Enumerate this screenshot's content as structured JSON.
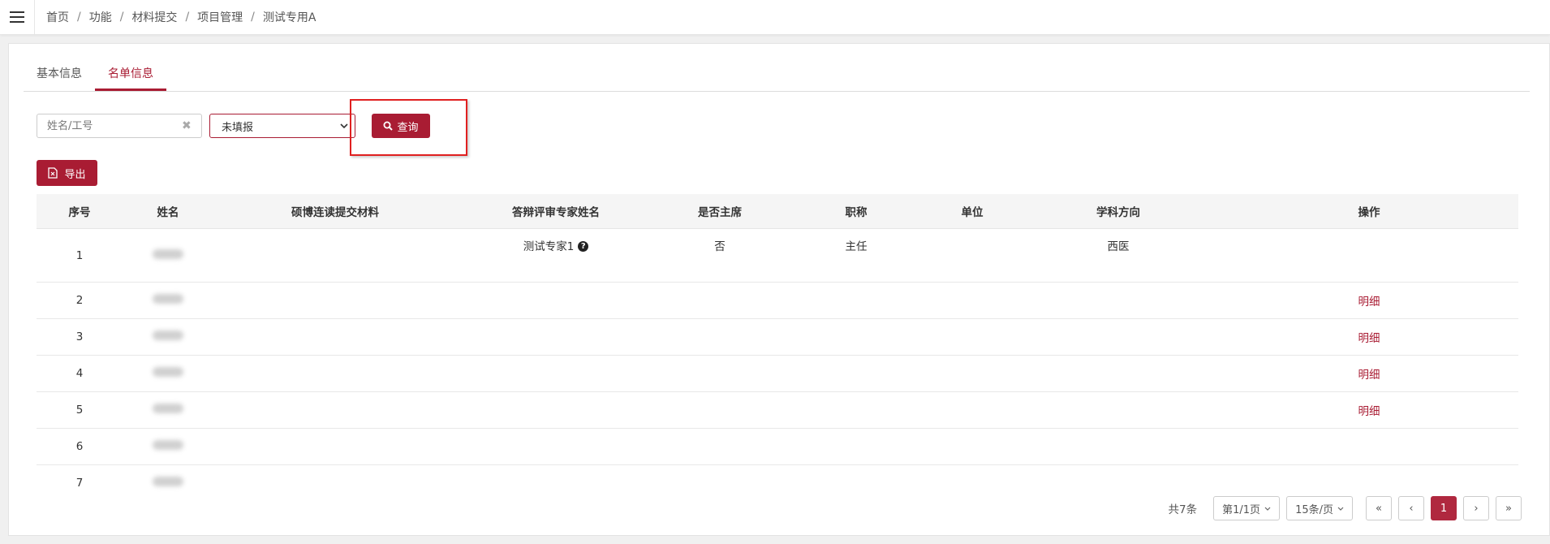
{
  "breadcrumb": [
    "首页",
    "功能",
    "材料提交",
    "项目管理",
    "测试专用A"
  ],
  "tabs": [
    {
      "label": "基本信息",
      "active": false
    },
    {
      "label": "名单信息",
      "active": true
    }
  ],
  "search": {
    "placeholder": "姓名/工号",
    "value": ""
  },
  "filter": {
    "selected": "未填报"
  },
  "buttons": {
    "query": "查询",
    "export": "导出"
  },
  "table": {
    "headers": [
      "序号",
      "姓名",
      "硕博连读提交材料",
      "答辩评审专家姓名",
      "是否主席",
      "职称",
      "单位",
      "学科方向",
      "操作"
    ],
    "rows": [
      {
        "no": "1",
        "material": "",
        "expert": "测试专家1",
        "chair": "否",
        "title": "主任",
        "unit": "",
        "subject": "西医",
        "action": ""
      },
      {
        "no": "2",
        "material": "",
        "expert": "",
        "chair": "",
        "title": "",
        "unit": "",
        "subject": "",
        "action": "明细"
      },
      {
        "no": "3",
        "material": "",
        "expert": "",
        "chair": "",
        "title": "",
        "unit": "",
        "subject": "",
        "action": "明细"
      },
      {
        "no": "4",
        "material": "",
        "expert": "",
        "chair": "",
        "title": "",
        "unit": "",
        "subject": "",
        "action": "明细"
      },
      {
        "no": "5",
        "material": "",
        "expert": "",
        "chair": "",
        "title": "",
        "unit": "",
        "subject": "",
        "action": "明细"
      },
      {
        "no": "6",
        "material": "",
        "expert": "",
        "chair": "",
        "title": "",
        "unit": "",
        "subject": "",
        "action": ""
      },
      {
        "no": "7",
        "material": "",
        "expert": "",
        "chair": "",
        "title": "",
        "unit": "",
        "subject": "",
        "action": ""
      }
    ]
  },
  "pagination": {
    "total": "共7条",
    "page_info": "第1/1页",
    "page_size": "15条/页",
    "current": "1",
    "first": "«",
    "prev": "‹",
    "next": "›",
    "last": "»"
  },
  "colors": {
    "accent": "#a91c33",
    "highlight": "#e02020"
  },
  "icons": {
    "menu": "hamburger-menu-icon",
    "search": "search-icon",
    "export": "export-file-icon",
    "help": "question-circle-icon"
  }
}
